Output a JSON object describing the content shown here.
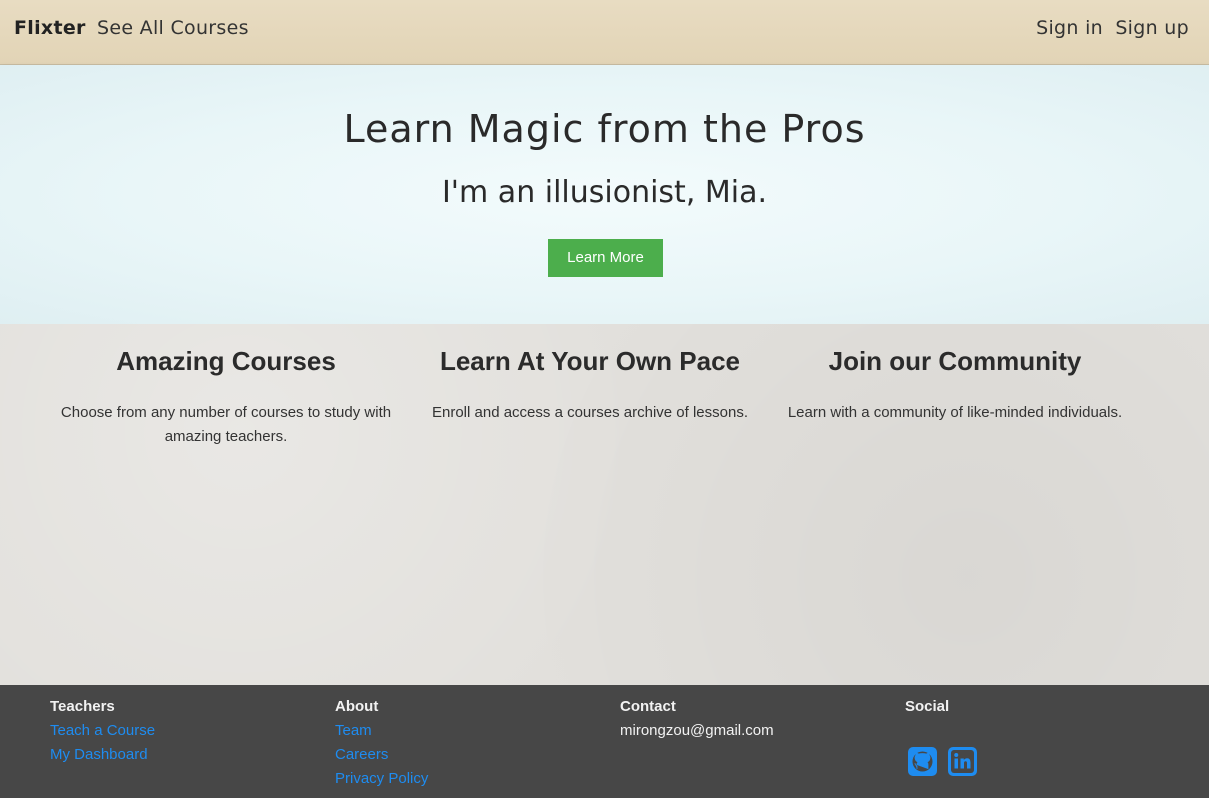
{
  "nav": {
    "brand": "Flixter",
    "all_courses": "See All Courses",
    "sign_in": "Sign in",
    "sign_up": "Sign up"
  },
  "hero": {
    "title": "Learn Magic from the Pros",
    "subtitle": "I'm an illusionist, Mia.",
    "cta_label": "Learn More"
  },
  "features": [
    {
      "title": "Amazing Courses",
      "text": "Choose from any number of courses to study with amazing teachers."
    },
    {
      "title": "Learn At Your Own Pace",
      "text": "Enroll and access a courses archive of lessons."
    },
    {
      "title": "Join our Community",
      "text": "Learn with a community of like-minded individuals."
    }
  ],
  "footer": {
    "teachers": {
      "heading": "Teachers",
      "links": [
        "Teach a Course",
        "My Dashboard"
      ]
    },
    "about": {
      "heading": "About",
      "links": [
        "Team",
        "Careers",
        "Privacy Policy"
      ]
    },
    "contact": {
      "heading": "Contact",
      "email": "mirongzou@gmail.com"
    },
    "social": {
      "heading": "Social",
      "icons": [
        "github-icon",
        "linkedin-icon"
      ]
    }
  },
  "colors": {
    "accent_green": "#4cae4c",
    "link_blue": "#1e8cf0",
    "footer_bg": "#474747"
  }
}
